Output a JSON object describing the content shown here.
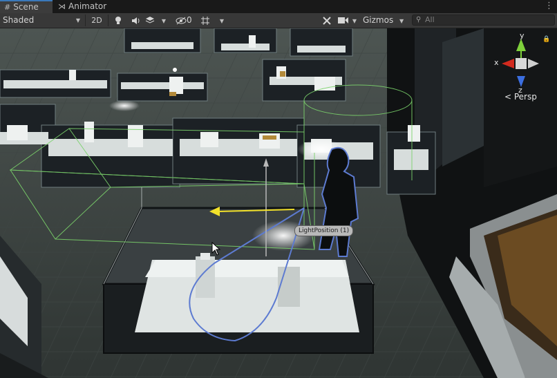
{
  "tabs": {
    "scene_label": "Scene",
    "animator_label": "Animator",
    "more_label": "⋮"
  },
  "toolbar": {
    "shading_mode": "Shaded",
    "mode_2d": "2D",
    "hidden_count": "0",
    "gizmos_label": "Gizmos",
    "search_placeholder": "All"
  },
  "viewport": {
    "selected_object_label": "LightPosition (1)",
    "projection_label": "< Persp"
  },
  "axis_gizmo": {
    "x": "x",
    "y": "y",
    "z": "z"
  },
  "icons": [
    "scene-grid-icon",
    "animator-icon",
    "lighting-toggle-icon",
    "audio-toggle-icon",
    "effects-icon",
    "hidden-objects-icon",
    "grid-icon",
    "tools-icon",
    "camera-icon",
    "search-icon",
    "lock-icon",
    "mouse-cursor-icon"
  ],
  "colors": {
    "accent_tab": "#3a79bb",
    "selection_outline": "#5d7bd1",
    "bounds_green": "#7bd36b",
    "axis_x": "#d22a1e",
    "axis_y": "#7fd13b",
    "axis_z": "#3b6ee0",
    "move_handle": "#f2e12a"
  }
}
